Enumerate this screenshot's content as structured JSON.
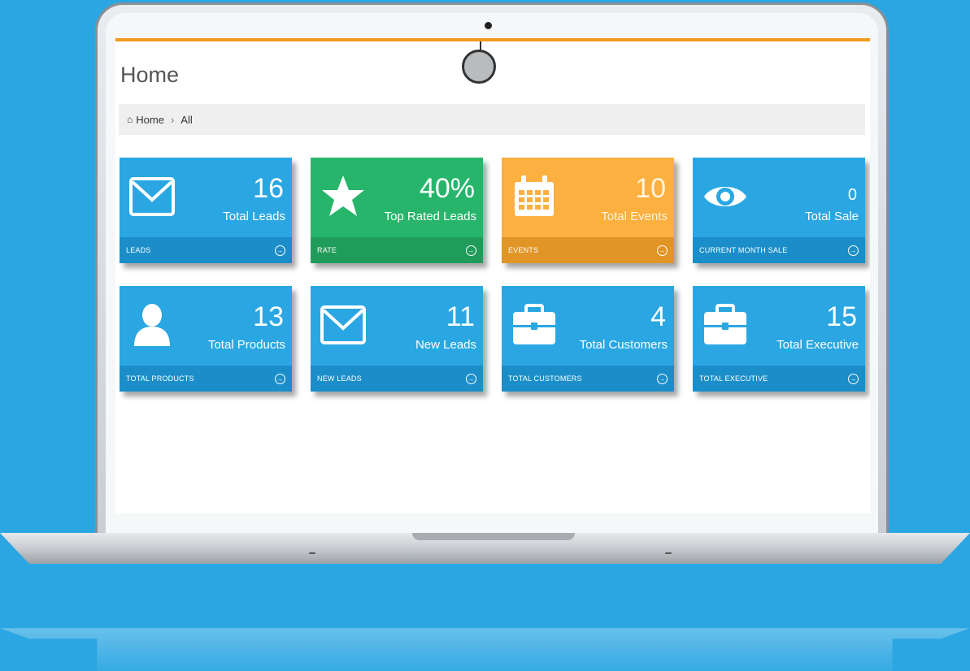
{
  "page": {
    "title": "Home"
  },
  "breadcrumb": {
    "home_label": "Home",
    "separator": "›",
    "current": "All"
  },
  "tiles": [
    {
      "value": "16",
      "label": "Total Leads",
      "footer": "LEADS",
      "icon": "envelope-icon",
      "color": "#2aa7e2"
    },
    {
      "value": "40%",
      "label": "Top Rated Leads",
      "footer": "RATE",
      "icon": "star-icon",
      "color": "#27b56b"
    },
    {
      "value": "10",
      "label": "Total Events",
      "footer": "EVENTS",
      "icon": "calendar-icon",
      "color": "#fbb040"
    },
    {
      "value": "0",
      "label": "Total Sale",
      "footer": "CURRENT MONTH SALE",
      "icon": "eye-icon",
      "color": "#2aa7e2"
    },
    {
      "value": "13",
      "label": "Total Products",
      "footer": "TOTAL PRODUCTS",
      "icon": "user-icon",
      "color": "#2aa7e2"
    },
    {
      "value": "11",
      "label": "New Leads",
      "footer": "NEW LEADS",
      "icon": "envelope-icon",
      "color": "#2aa7e2"
    },
    {
      "value": "4",
      "label": "Total Customers",
      "footer": "TOTAL CUSTOMERS",
      "icon": "briefcase-icon",
      "color": "#2aa7e2"
    },
    {
      "value": "15",
      "label": "Total Executive",
      "footer": "TOTAL EXECUTIVE",
      "icon": "briefcase-icon",
      "color": "#2aa7e2"
    }
  ],
  "colors": {
    "background": "#2aa6e2",
    "accent_bar": "#f29a1a"
  }
}
